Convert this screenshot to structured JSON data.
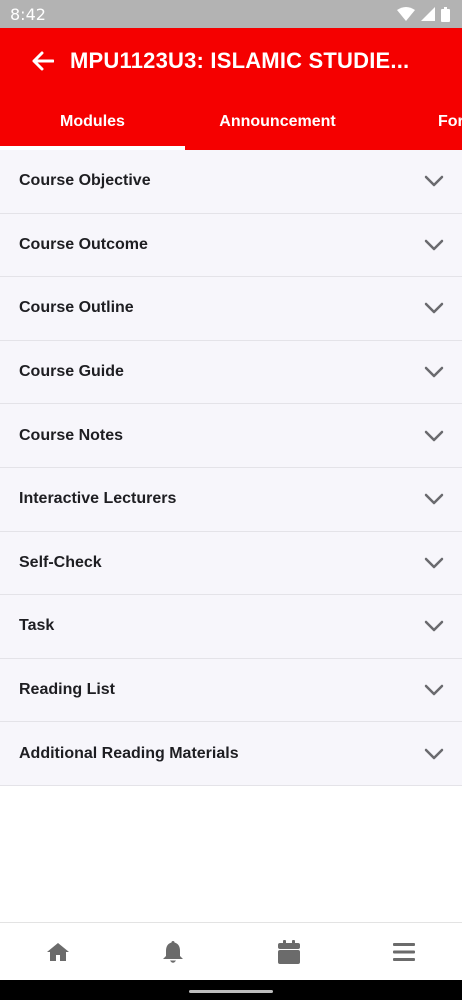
{
  "status_bar": {
    "time": "8:42",
    "icons": [
      "wifi-icon",
      "signal-icon",
      "battery-icon"
    ]
  },
  "app_bar": {
    "back_icon": "arrow-left-icon",
    "title": "MPU1123U3: ISLAMIC STUDIE..."
  },
  "tabs": [
    {
      "label": "Modules",
      "selected": true
    },
    {
      "label": "Announcement",
      "selected": false
    },
    {
      "label": "Forum",
      "selected": false
    }
  ],
  "modules": [
    {
      "label": "Course Objective"
    },
    {
      "label": "Course Outcome"
    },
    {
      "label": "Course Outline"
    },
    {
      "label": "Course Guide"
    },
    {
      "label": "Course Notes"
    },
    {
      "label": "Interactive Lecturers"
    },
    {
      "label": "Self-Check"
    },
    {
      "label": "Task"
    },
    {
      "label": "Reading List"
    },
    {
      "label": "Additional Reading Materials"
    }
  ],
  "bottom_nav": [
    "home-icon",
    "bell-icon",
    "calendar-icon",
    "menu-icon"
  ],
  "colors": {
    "primary": "#f50000",
    "row_bg": "#f7f6fb",
    "nav_icon": "#6b6b6b"
  }
}
